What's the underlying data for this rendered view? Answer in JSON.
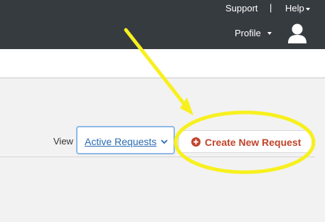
{
  "header": {
    "support_label": "Support",
    "separator": "|",
    "help_label": "Help",
    "profile_label": "Profile",
    "background_color": "#363b40"
  },
  "toolbar": {
    "view_label": "View",
    "view_selected": "Active Requests",
    "create_button_label": "Create New Request",
    "accent_color": "#c0442b",
    "link_color": "#2a6ab0"
  },
  "annotation": {
    "color": "#f7f01e",
    "shapes": [
      "arrow",
      "ellipse"
    ]
  }
}
